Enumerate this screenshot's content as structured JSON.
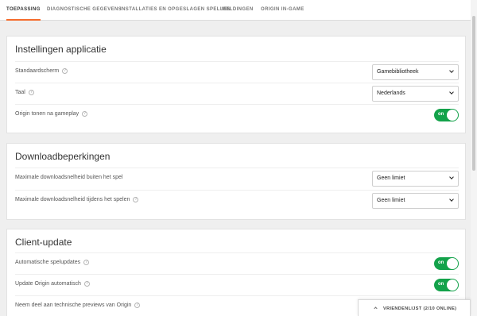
{
  "tabs": [
    {
      "label": "TOEPASSING",
      "active": true
    },
    {
      "label": "DIAGNOSTISCHE GEGEVENS",
      "active": false
    },
    {
      "label": "INSTALLATIES EN OPGESLAGEN SPELLEN",
      "active": false
    },
    {
      "label": "MELDINGEN",
      "active": false
    },
    {
      "label": "ORIGIN IN-GAME",
      "active": false
    }
  ],
  "sections": {
    "app": {
      "title": "Instellingen applicatie",
      "default_screen": {
        "label": "Standaardscherm",
        "value": "Gamebibliotheek"
      },
      "language": {
        "label": "Taal",
        "value": "Nederlands"
      },
      "show_in_game": {
        "label": "Origin tonen na gameplay",
        "state": "on"
      }
    },
    "downloads": {
      "title": "Downloadbeperkingen",
      "outside_game": {
        "label": "Maximale downloadsnelheid buiten het spel",
        "value": "Geen limiet"
      },
      "during_game": {
        "label": "Maximale downloadsnelheid tijdens het spelen",
        "value": "Geen limiet"
      }
    },
    "client_update": {
      "title": "Client-update",
      "auto_game_updates": {
        "label": "Automatische spelupdates",
        "state": "on"
      },
      "auto_origin_update": {
        "label": "Update Origin automatisch",
        "state": "on"
      },
      "tech_previews": {
        "label": "Neem deel aan technische previews van Origin"
      }
    }
  },
  "friends": {
    "label": "VRIENDENLIJST (2/10 ONLINE)"
  },
  "help_glyph": "?",
  "colors": {
    "accent": "#f56c2d",
    "toggle_on": "#13a24a"
  }
}
